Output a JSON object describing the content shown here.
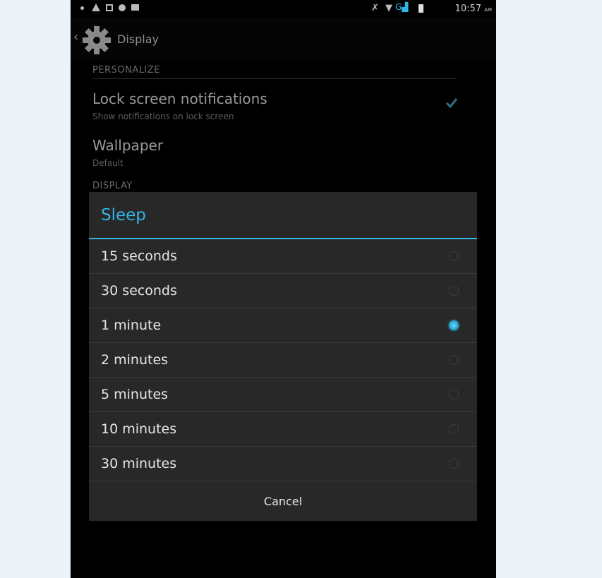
{
  "status_bar": {
    "time": "10:57",
    "ampm": "AM"
  },
  "action_bar": {
    "title": "Display"
  },
  "settings": {
    "personalize_header": "PERSONALIZE",
    "lock_screen": {
      "title": "Lock screen notifications",
      "summary": "Show notifications on lock screen",
      "checked": true
    },
    "wallpaper": {
      "title": "Wallpaper",
      "summary": "Default"
    },
    "display_header": "DISPLAY"
  },
  "dialog": {
    "title": "Sleep",
    "options": [
      {
        "label": "15 seconds",
        "selected": false
      },
      {
        "label": "30 seconds",
        "selected": false
      },
      {
        "label": "1 minute",
        "selected": true
      },
      {
        "label": "2 minutes",
        "selected": false
      },
      {
        "label": "5 minutes",
        "selected": false
      },
      {
        "label": "10 minutes",
        "selected": false
      },
      {
        "label": "30 minutes",
        "selected": false
      }
    ],
    "cancel_label": "Cancel"
  },
  "colors": {
    "accent": "#33b5e5",
    "dialog_bg": "#282828",
    "screen_bg": "#000000"
  }
}
